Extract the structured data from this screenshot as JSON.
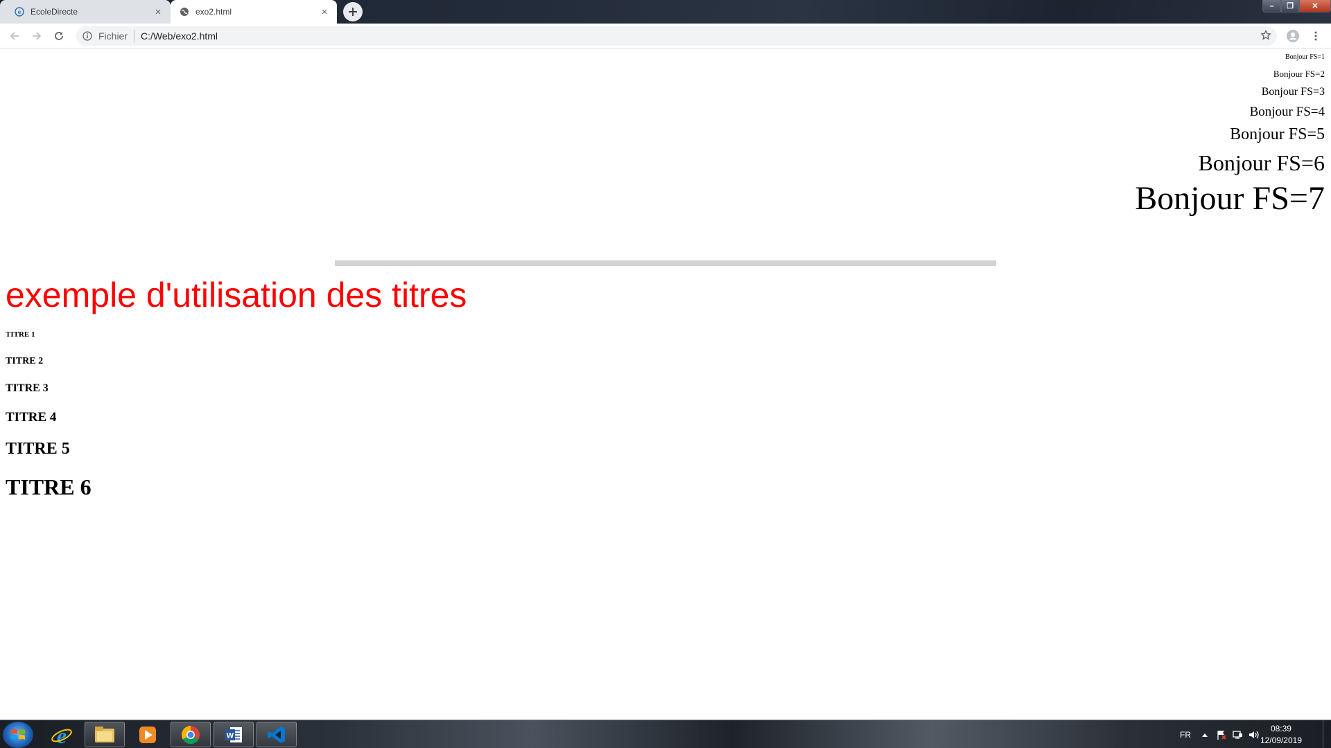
{
  "browser": {
    "tabs": [
      {
        "title": "EcoleDirecte",
        "active": false,
        "icon": "ecoledirecte-icon"
      },
      {
        "title": "exo2.html",
        "active": true,
        "icon": "globe-icon"
      }
    ],
    "address": {
      "scheme_label": "Fichier",
      "url": "C:/Web/exo2.html"
    },
    "window_controls": {
      "minimize": "–",
      "maximize": "❐",
      "close": "✕"
    }
  },
  "page": {
    "font_sizes": [
      {
        "text": "Bonjour FS=1",
        "size": 1
      },
      {
        "text": "Bonjour FS=2",
        "size": 2
      },
      {
        "text": "Bonjour FS=3",
        "size": 3
      },
      {
        "text": "Bonjour FS=4",
        "size": 4
      },
      {
        "text": "Bonjour FS=5",
        "size": 5
      },
      {
        "text": "Bonjour FS=6",
        "size": 6
      },
      {
        "text": "Bonjour FS=7",
        "size": 7
      }
    ],
    "red_title": "exemple d'utilisation des titres",
    "red_color": "#ff0000",
    "titles": [
      "TITRE 1",
      "TITRE 2",
      "TITRE 3",
      "TITRE 4",
      "TITRE 5",
      "TITRE 6"
    ]
  },
  "taskbar": {
    "apps": [
      "internet-explorer",
      "file-explorer",
      "media-player",
      "chrome",
      "word",
      "vscode"
    ],
    "language": "FR",
    "time": "08:39",
    "date": "12/09/2019"
  }
}
